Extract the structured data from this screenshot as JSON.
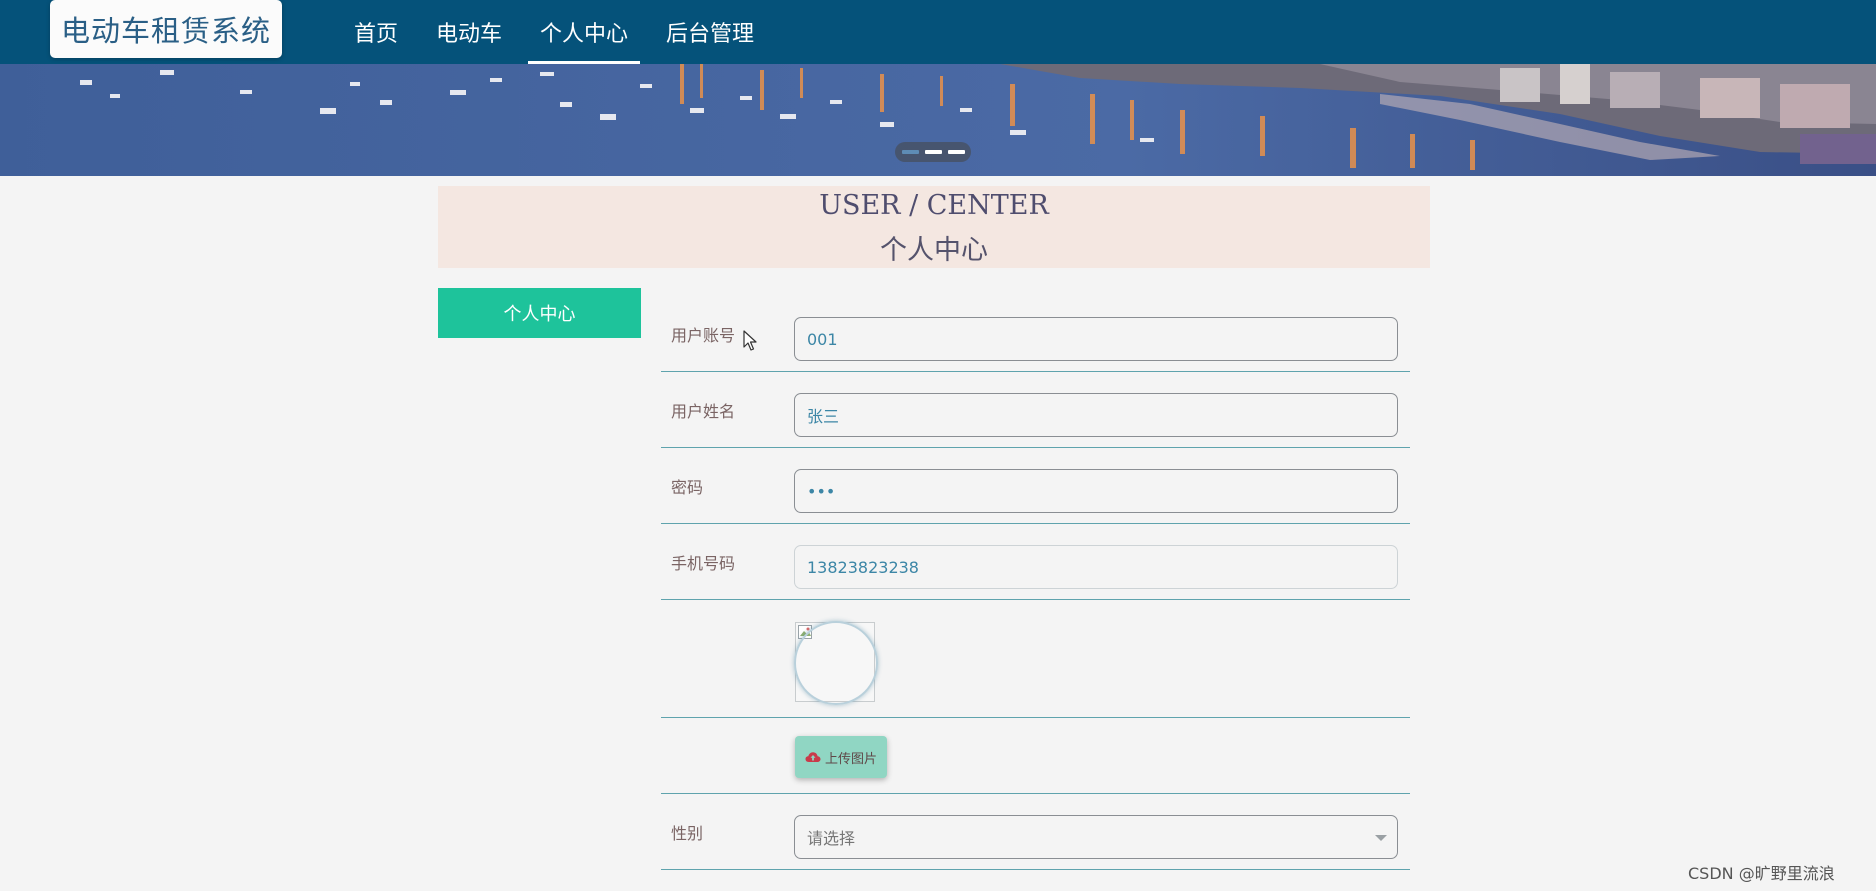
{
  "header": {
    "brand": "电动车租赁系统",
    "nav": [
      {
        "label": "首页"
      },
      {
        "label": "电动车"
      },
      {
        "label": "个人中心",
        "active": true
      },
      {
        "label": "后台管理"
      }
    ],
    "colors": {
      "bar": "#05527a",
      "accent": "#1ec39b"
    }
  },
  "banner": {
    "slides": 3,
    "active_slide": 1
  },
  "section": {
    "title_en": "USER / CENTER",
    "title_zh": "个人中心"
  },
  "sidebar": {
    "items": [
      {
        "label": "个人中心"
      }
    ]
  },
  "form": {
    "account": {
      "label": "用户账号",
      "value": "001"
    },
    "name": {
      "label": "用户姓名",
      "value": "张三"
    },
    "password": {
      "label": "密码",
      "value": "•••"
    },
    "phone": {
      "label": "手机号码",
      "value": "13823823238"
    },
    "upload": {
      "label": "上传图片",
      "icon": "cloud-upload-icon"
    },
    "gender": {
      "label": "性别",
      "placeholder": "请选择"
    }
  },
  "watermark": "CSDN @旷野里流浪"
}
